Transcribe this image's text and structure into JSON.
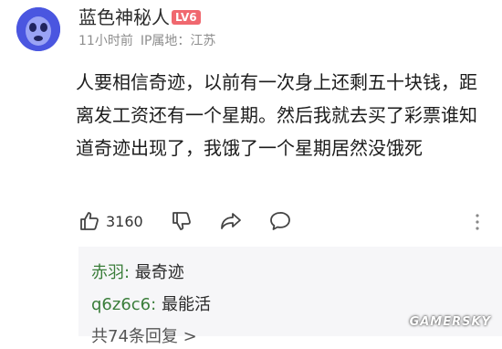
{
  "post": {
    "username": "蓝色神秘人",
    "level_badge": "LV6",
    "time": "11小时前",
    "ip_location": "IP属地：江苏",
    "content": "人要相信奇迹，以前有一次身上还剩五十块钱，距离发工资还有一个星期。然后我就去买了彩票谁知道奇迹出现了，我饿了一个星期居然没饿死",
    "likes": "3160",
    "icons": [
      "like-icon",
      "dislike-icon",
      "share-icon",
      "comment-icon",
      "more-icon"
    ]
  },
  "replies": {
    "items": [
      {
        "author": "赤羽",
        "separator": ":",
        "text": " 最奇迹"
      },
      {
        "author": "q6z6c6",
        "separator": ":",
        "text": " 最能活"
      }
    ],
    "count_text": "共74条回复 >"
  },
  "watermark": "GAMERSKY",
  "colors": {
    "avatar_bg": "#4a56e0",
    "level_badge": "#f0686f",
    "reply_author": "#3a7d3a",
    "reply_bg": "#f6f6f8"
  }
}
